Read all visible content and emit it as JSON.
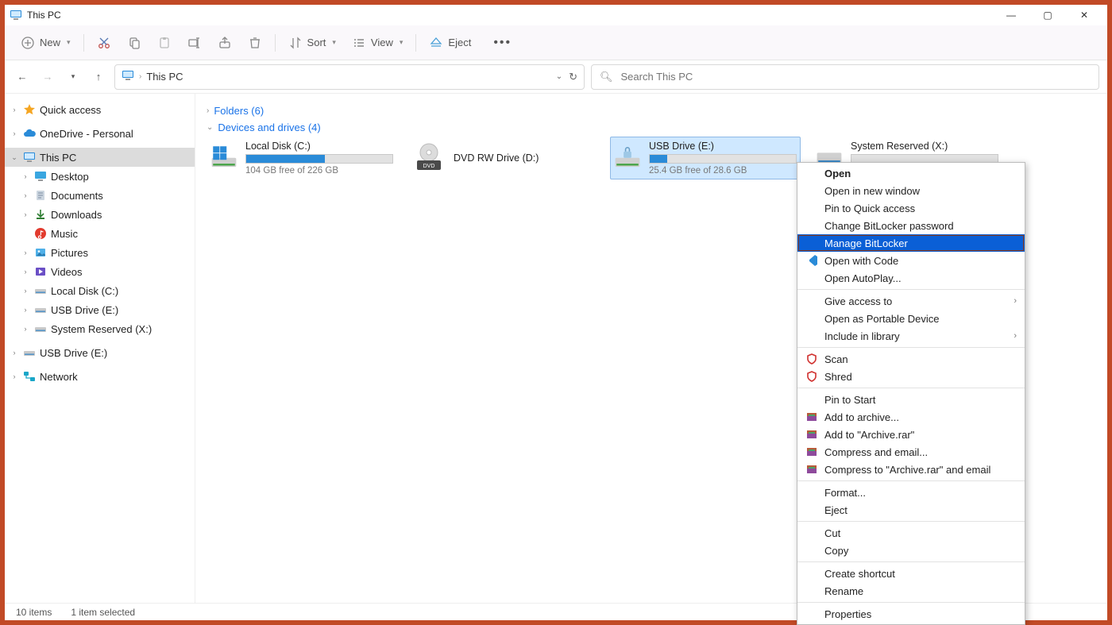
{
  "window": {
    "title": "This PC"
  },
  "toolbar": {
    "new": "New",
    "sort": "Sort",
    "view": "View",
    "eject": "Eject"
  },
  "address": {
    "path": "This PC",
    "search_placeholder": "Search This PC"
  },
  "sidebar": {
    "quick_access": "Quick access",
    "onedrive": "OneDrive - Personal",
    "this_pc": "This PC",
    "children": {
      "desktop": "Desktop",
      "documents": "Documents",
      "downloads": "Downloads",
      "music": "Music",
      "pictures": "Pictures",
      "videos": "Videos",
      "local_disk": "Local Disk (C:)",
      "usb_e": "USB Drive (E:)",
      "sys_res": "System Reserved (X:)"
    },
    "usb_e_outer": "USB Drive (E:)",
    "network": "Network"
  },
  "groups": {
    "folders": "Folders (6)",
    "drives": "Devices and drives (4)"
  },
  "drives": [
    {
      "name": "Local Disk (C:)",
      "free": "104 GB free of 226 GB",
      "fillpct": 54
    },
    {
      "name": "DVD RW Drive (D:)",
      "free": "",
      "fillpct": 0
    },
    {
      "name": "USB Drive (E:)",
      "free": "25.4 GB free of 28.6 GB",
      "fillpct": 12
    },
    {
      "name": "System Reserved (X:)",
      "free": "",
      "fillpct": 0
    }
  ],
  "context_menu": {
    "open": "Open",
    "new_window": "Open in new window",
    "pin_quick": "Pin to Quick access",
    "change_pw": "Change BitLocker password",
    "manage_bl": "Manage BitLocker",
    "open_code": "Open with Code",
    "autoplay": "Open AutoPlay...",
    "give_access": "Give access to",
    "portable": "Open as Portable Device",
    "include_lib": "Include in library",
    "scan": "Scan",
    "shred": "Shred",
    "pin_start": "Pin to Start",
    "add_archive": "Add to archive...",
    "add_rar": "Add to \"Archive.rar\"",
    "compress_email": "Compress and email...",
    "compress_rar_email": "Compress to \"Archive.rar\" and email",
    "format": "Format...",
    "eject": "Eject",
    "cut": "Cut",
    "copy": "Copy",
    "shortcut": "Create shortcut",
    "rename": "Rename",
    "properties": "Properties"
  },
  "status": {
    "items": "10 items",
    "selected": "1 item selected"
  }
}
